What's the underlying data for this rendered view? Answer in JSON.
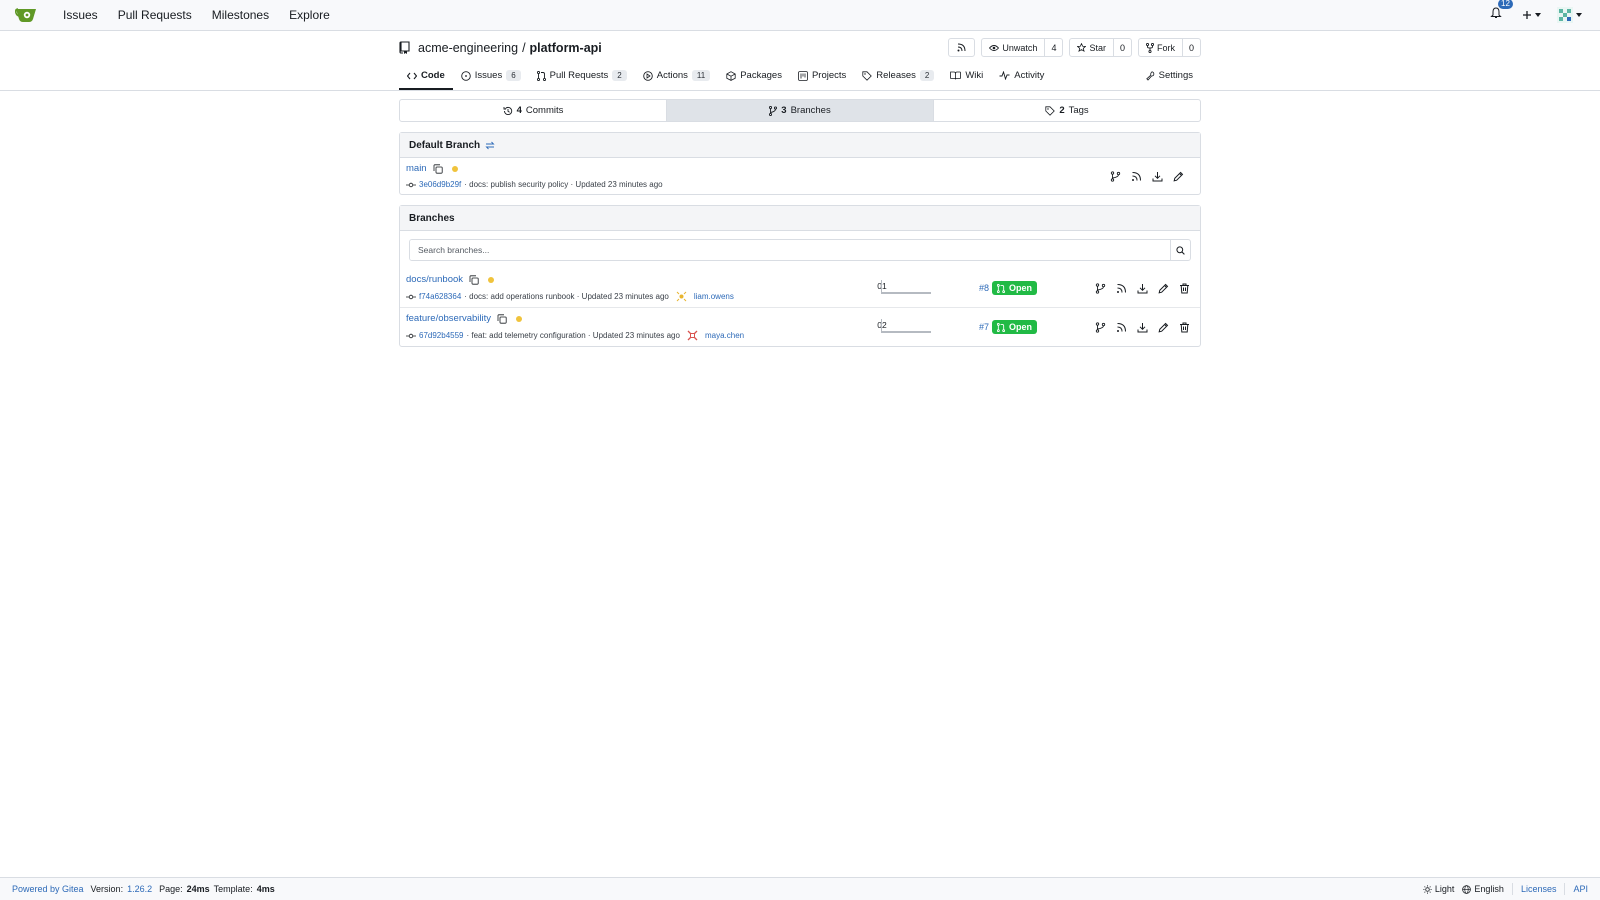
{
  "nav": {
    "links": [
      "Issues",
      "Pull Requests",
      "Milestones",
      "Explore"
    ],
    "notification_count": "12"
  },
  "repo": {
    "owner": "acme-engineering",
    "separator": "/",
    "name": "platform-api",
    "watch_label": "Unwatch",
    "watch_count": "4",
    "star_label": "Star",
    "star_count": "0",
    "fork_label": "Fork",
    "fork_count": "0"
  },
  "tabs": [
    {
      "label": "Code"
    },
    {
      "label": "Issues",
      "count": "6"
    },
    {
      "label": "Pull Requests",
      "count": "2"
    },
    {
      "label": "Actions",
      "count": "11"
    },
    {
      "label": "Packages"
    },
    {
      "label": "Projects"
    },
    {
      "label": "Releases",
      "count": "2"
    },
    {
      "label": "Wiki"
    },
    {
      "label": "Activity"
    },
    {
      "label": "Settings"
    }
  ],
  "summary": {
    "commits_count": "4",
    "commits_label": "Commits",
    "branches_count": "3",
    "branches_label": "Branches",
    "tags_count": "2",
    "tags_label": "Tags"
  },
  "default_branch": {
    "heading": "Default Branch",
    "name": "main",
    "sha": "3e06d9b29f",
    "message": "· docs: publish security policy · Updated 23 minutes ago"
  },
  "branches_section": {
    "heading": "Branches",
    "search_placeholder": "Search branches...",
    "items": [
      {
        "name": "docs/runbook",
        "sha": "f74a628364",
        "message": "· docs: add operations runbook · Updated 23 minutes ago",
        "author": "liam.owens",
        "behind": "0",
        "ahead": "1",
        "pr_number": "#8",
        "pr_status": "Open"
      },
      {
        "name": "feature/observability",
        "sha": "67d92b4559",
        "message": "· feat: add telemetry configuration · Updated 23 minutes ago",
        "author": "maya.chen",
        "behind": "0",
        "ahead": "2",
        "pr_number": "#7",
        "pr_status": "Open"
      }
    ]
  },
  "footer": {
    "powered": "Powered by Gitea",
    "version_label": "Version:",
    "version": "1.26.2",
    "page_label": "Page:",
    "page_time": "24ms",
    "template_label": "Template:",
    "template_time": "4ms",
    "theme": "Light",
    "language": "English",
    "licenses": "Licenses",
    "api": "API"
  },
  "colors": {
    "accent": "#2d6ab8",
    "open_badge": "#21ba45",
    "status_dot": "#f0c33c",
    "logo_green": "#609926"
  }
}
